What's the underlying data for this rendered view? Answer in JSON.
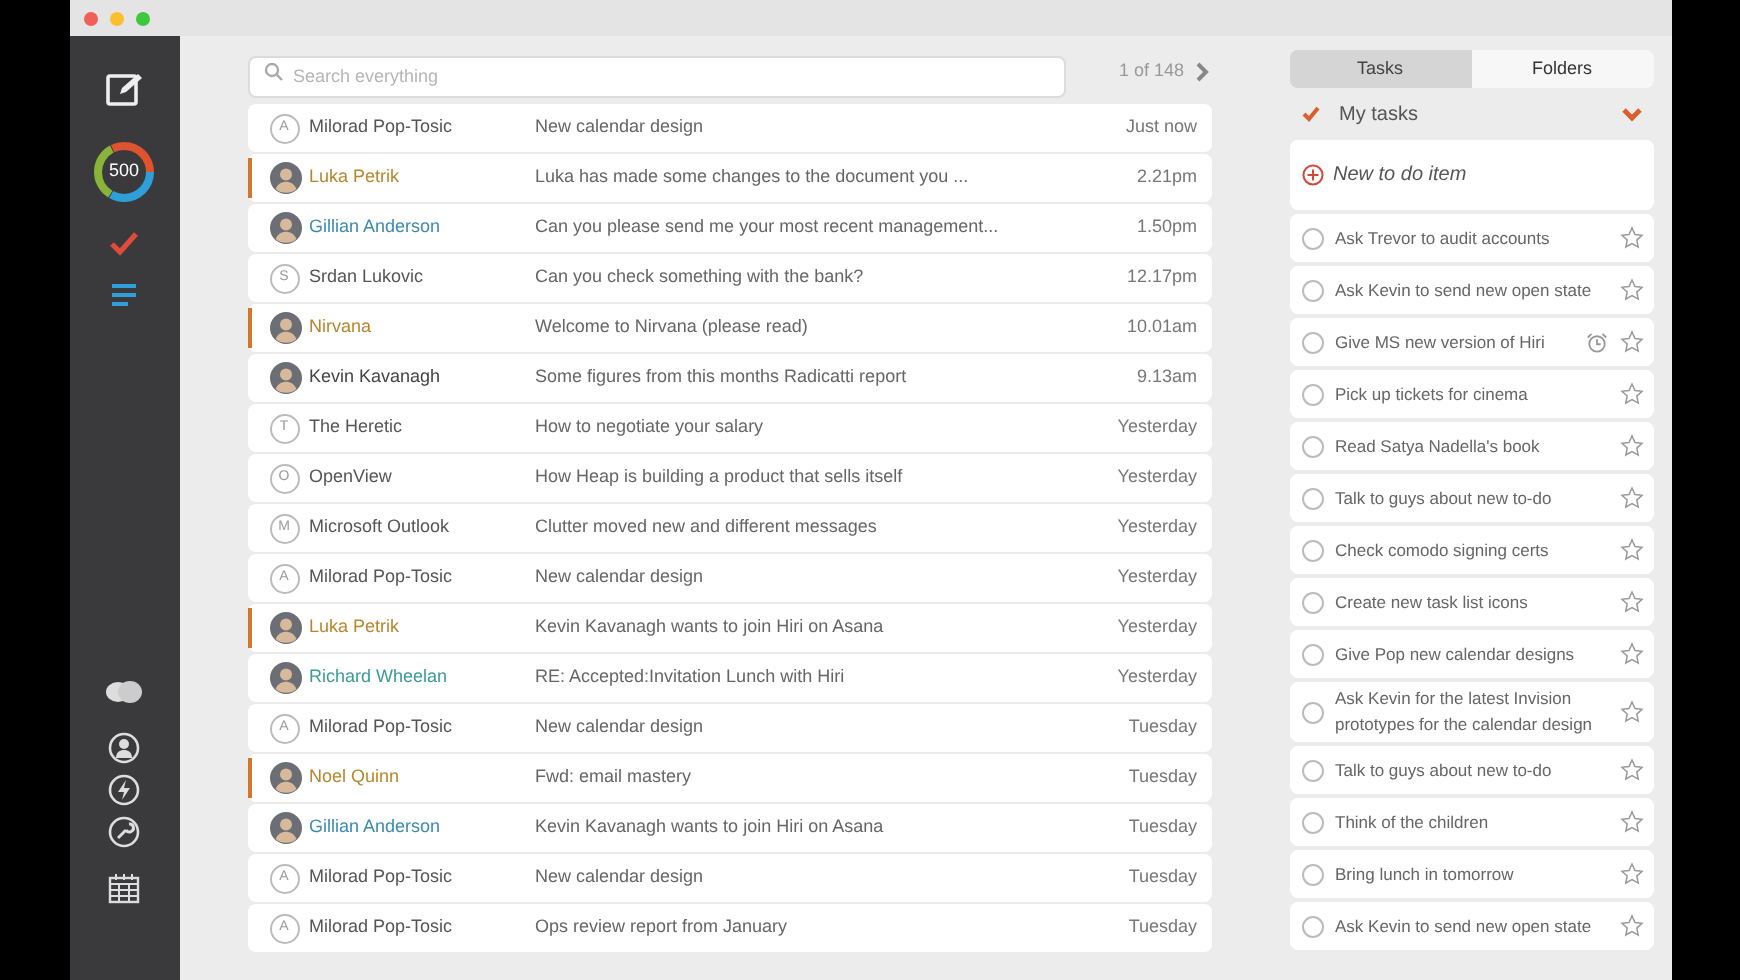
{
  "search": {
    "placeholder": "Search everything"
  },
  "pager": {
    "text": "1 of 148"
  },
  "sidebar": {
    "counter": "500"
  },
  "messages": [
    {
      "avatar": {
        "kind": "initial",
        "initial": "A"
      },
      "sender": "Milorad Pop-Tosic",
      "color": "#555555",
      "flagged": false,
      "subject": "New calendar design",
      "time": "Just now"
    },
    {
      "avatar": {
        "kind": "photo"
      },
      "sender": "Luka Petrik",
      "color": "#b8862b",
      "flagged": true,
      "subject": "Luka has made some changes to the document you ...",
      "time": "2.21pm"
    },
    {
      "avatar": {
        "kind": "photo"
      },
      "sender": "Gillian Anderson",
      "color": "#3b8bb0",
      "flagged": false,
      "subject": "Can you please send me your most recent management...",
      "time": "1.50pm"
    },
    {
      "avatar": {
        "kind": "initial",
        "initial": "S"
      },
      "sender": "Srdan Lukovic",
      "color": "#555555",
      "flagged": false,
      "subject": "Can you check something with the bank?",
      "time": "12.17pm"
    },
    {
      "avatar": {
        "kind": "photo"
      },
      "sender": "Nirvana",
      "color": "#b8862b",
      "flagged": true,
      "subject": "Welcome to Nirvana (please read)",
      "time": "10.01am"
    },
    {
      "avatar": {
        "kind": "photo"
      },
      "sender": "Kevin Kavanagh",
      "color": "#444444",
      "flagged": false,
      "subject": "Some figures from this months Radicatti report",
      "time": "9.13am"
    },
    {
      "avatar": {
        "kind": "initial",
        "initial": "T"
      },
      "sender": "The Heretic",
      "color": "#555555",
      "flagged": false,
      "subject": "How to negotiate your salary",
      "time": "Yesterday"
    },
    {
      "avatar": {
        "kind": "initial",
        "initial": "O"
      },
      "sender": "OpenView",
      "color": "#555555",
      "flagged": false,
      "subject": "How Heap is building a product that sells itself",
      "time": "Yesterday"
    },
    {
      "avatar": {
        "kind": "initial",
        "initial": "M"
      },
      "sender": "Microsoft Outlook",
      "color": "#555555",
      "flagged": false,
      "subject": "Clutter moved new and different messages",
      "time": "Yesterday"
    },
    {
      "avatar": {
        "kind": "initial",
        "initial": "A"
      },
      "sender": "Milorad Pop-Tosic",
      "color": "#555555",
      "flagged": false,
      "subject": "New calendar design",
      "time": "Yesterday"
    },
    {
      "avatar": {
        "kind": "photo"
      },
      "sender": "Luka Petrik",
      "color": "#b8862b",
      "flagged": true,
      "subject": "Kevin Kavanagh wants to join Hiri on Asana",
      "time": "Yesterday"
    },
    {
      "avatar": {
        "kind": "photo"
      },
      "sender": "Richard Wheelan",
      "color": "#3b9a9a",
      "flagged": false,
      "subject": "RE: Accepted:Invitation Lunch with Hiri",
      "time": "Yesterday"
    },
    {
      "avatar": {
        "kind": "initial",
        "initial": "A"
      },
      "sender": "Milorad Pop-Tosic",
      "color": "#555555",
      "flagged": false,
      "subject": "New calendar design",
      "time": "Tuesday"
    },
    {
      "avatar": {
        "kind": "photo"
      },
      "sender": "Noel Quinn",
      "color": "#b8862b",
      "flagged": true,
      "subject": "Fwd: email mastery",
      "time": "Tuesday"
    },
    {
      "avatar": {
        "kind": "photo"
      },
      "sender": "Gillian Anderson",
      "color": "#3b8bb0",
      "flagged": false,
      "subject": "Kevin Kavanagh wants to join Hiri on Asana",
      "time": "Tuesday"
    },
    {
      "avatar": {
        "kind": "initial",
        "initial": "A"
      },
      "sender": "Milorad Pop-Tosic",
      "color": "#555555",
      "flagged": false,
      "subject": "New calendar design",
      "time": "Tuesday"
    },
    {
      "avatar": {
        "kind": "initial",
        "initial": "A"
      },
      "sender": "Milorad Pop-Tosic",
      "color": "#555555",
      "flagged": false,
      "subject": "Ops review report from January",
      "time": "Tuesday"
    }
  ],
  "tabs": [
    {
      "label": "Tasks",
      "selected": true
    },
    {
      "label": "Folders",
      "selected": false
    }
  ],
  "task_list": {
    "title": "My tasks",
    "expanded": true
  },
  "new_item": {
    "placeholder": "New to do item"
  },
  "tasks": [
    {
      "text": "Ask Trevor to audit accounts",
      "checked": false,
      "starred": false,
      "reminder": false
    },
    {
      "text": "Ask Kevin to send new open state",
      "checked": false,
      "starred": false,
      "reminder": false
    },
    {
      "text": "Give MS new version of Hiri",
      "checked": false,
      "starred": false,
      "reminder": true
    },
    {
      "text": "Pick up tickets for cinema",
      "checked": false,
      "starred": false,
      "reminder": false
    },
    {
      "text": "Read Satya Nadella's book",
      "checked": false,
      "starred": false,
      "reminder": false
    },
    {
      "text": "Talk to guys about new to-do",
      "checked": false,
      "starred": false,
      "reminder": false
    },
    {
      "text": "Check comodo signing certs",
      "checked": false,
      "starred": false,
      "reminder": false
    },
    {
      "text": "Create new task list icons",
      "checked": false,
      "starred": false,
      "reminder": false
    },
    {
      "text": "Give Pop new calendar designs",
      "checked": false,
      "starred": false,
      "reminder": false
    },
    {
      "text": "Ask Kevin for the latest Invision prototypes for the calendar design",
      "checked": false,
      "starred": false,
      "reminder": false
    },
    {
      "text": "Talk to guys about new to-do",
      "checked": false,
      "starred": false,
      "reminder": false
    },
    {
      "text": "Think of the children",
      "checked": false,
      "starred": false,
      "reminder": false
    },
    {
      "text": "Bring lunch in tomorrow",
      "checked": false,
      "starred": false,
      "reminder": false
    },
    {
      "text": "Ask Kevin to send new open state",
      "checked": false,
      "starred": false,
      "reminder": false
    }
  ]
}
